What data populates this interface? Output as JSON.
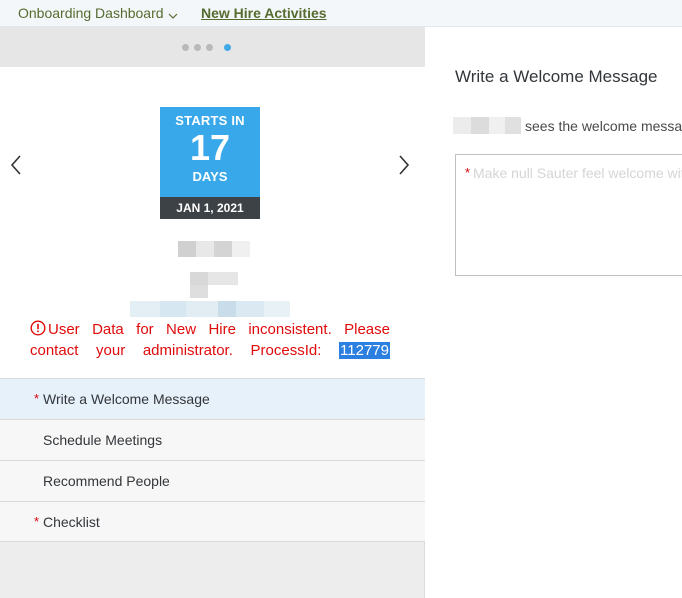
{
  "topbar": {
    "dashboard_label": "Onboarding Dashboard",
    "activities_label": "New Hire Activities"
  },
  "carousel": {
    "dot_count": 4,
    "active_index": 3
  },
  "badge": {
    "starts_in": "STARTS IN",
    "days_count": "17",
    "days_label": "DAYS",
    "date": "JAN 1, 2021"
  },
  "error": {
    "message": "User Data for New Hire inconsistent. Please contact your administrator. ProcessId:",
    "process_id": "112779"
  },
  "menu": {
    "items": [
      {
        "label": "Write a Welcome Message",
        "required": true,
        "selected": true
      },
      {
        "label": "Schedule Meetings",
        "required": false,
        "selected": false
      },
      {
        "label": "Recommend People",
        "required": false,
        "selected": false
      },
      {
        "label": "Checklist",
        "required": true,
        "selected": false
      }
    ]
  },
  "right": {
    "title": "Write a Welcome Message",
    "subtitle": "sees the welcome message",
    "placeholder": "Make null Sauter feel welcome with a message"
  },
  "colors": {
    "badge_blue": "#39a8ea",
    "badge_dark": "#3d4246",
    "error_red": "#e00b0b",
    "nav_green": "#556b2f",
    "selection_blue": "#2b7fe0"
  }
}
